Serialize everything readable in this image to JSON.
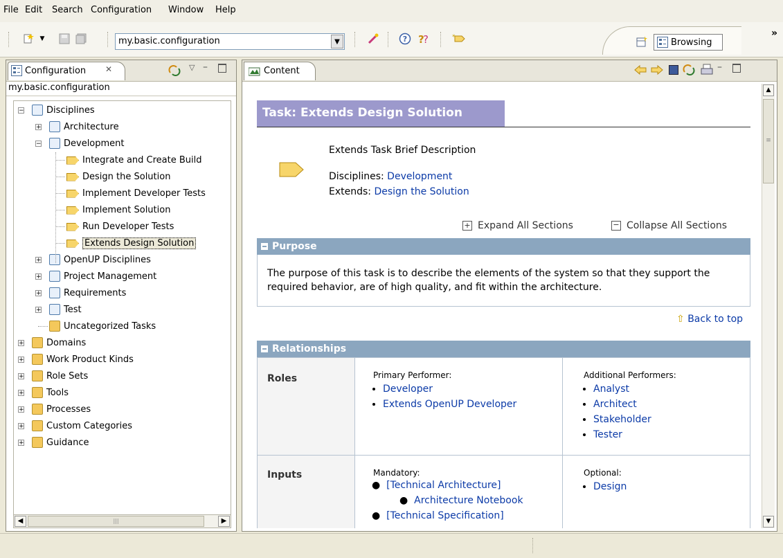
{
  "menu": [
    "File",
    "Edit",
    "Search",
    "Configuration",
    "Window",
    "Help"
  ],
  "toolbar": {
    "config_value": "my.basic.configuration",
    "perspective": "Browsing",
    "chevron": "»"
  },
  "library_view": {
    "tab_title": "Configuration",
    "config_name": "my.basic.configuration",
    "tree": [
      {
        "label": "Disciplines",
        "expander": "−",
        "icon": "discipline-group-icon"
      },
      {
        "label": "Architecture",
        "expander": "+",
        "icon": "discipline-icon"
      },
      {
        "label": "Development",
        "expander": "−",
        "icon": "discipline-icon"
      },
      {
        "label": "Integrate and Create Build",
        "icon": "task-icon"
      },
      {
        "label": "Design the Solution",
        "icon": "task-icon"
      },
      {
        "label": "Implement Developer Tests",
        "icon": "task-icon"
      },
      {
        "label": "Implement Solution",
        "icon": "task-icon"
      },
      {
        "label": "Run Developer Tests",
        "icon": "task-icon"
      },
      {
        "label": "Extends Design Solution",
        "icon": "task-icon",
        "selected": true
      },
      {
        "label": "OpenUP Disciplines",
        "expander": "+",
        "icon": "discipline-icon"
      },
      {
        "label": "Project Management",
        "expander": "+",
        "icon": "discipline-icon"
      },
      {
        "label": "Requirements",
        "expander": "+",
        "icon": "discipline-icon"
      },
      {
        "label": "Test",
        "expander": "+",
        "icon": "discipline-icon"
      },
      {
        "label": "Uncategorized Tasks",
        "icon": "uncategorized-icon"
      },
      {
        "label": "Domains",
        "expander": "+",
        "icon": "domain-folder-icon"
      },
      {
        "label": "Work Product Kinds",
        "expander": "+",
        "icon": "wpkind-folder-icon"
      },
      {
        "label": "Role Sets",
        "expander": "+",
        "icon": "roleset-folder-icon"
      },
      {
        "label": "Tools",
        "expander": "+",
        "icon": "tools-folder-icon"
      },
      {
        "label": "Processes",
        "expander": "+",
        "icon": "processes-folder-icon"
      },
      {
        "label": "Custom Categories",
        "expander": "+",
        "icon": "custom-folder-icon"
      },
      {
        "label": "Guidance",
        "expander": "+",
        "icon": "guidance-folder-icon"
      }
    ]
  },
  "content_view": {
    "tab_title": "Content",
    "task_title": "Task: Extends Design Solution",
    "brief": "Extends Task Brief Description",
    "disciplines_label": "Disciplines:",
    "disciplines_link": "Development",
    "extends_label": "Extends:",
    "extends_link": "Design the Solution",
    "expand_all": "Expand All Sections",
    "collapse_all": "Collapse All Sections",
    "purpose_title": "Purpose",
    "purpose_text": "The purpose of this task is to describe the elements of the system so that they support the required behavior, are of high quality, and fit within the architecture.",
    "back_to_top": "Back to top",
    "relationships_title": "Relationships",
    "roles_label": "Roles",
    "primary_label": "Primary Performer:",
    "primary_items": [
      "Developer",
      "Extends OpenUP Developer"
    ],
    "additional_label": "Additional Performers:",
    "additional_items": [
      "Analyst",
      "Architect",
      "Stakeholder",
      "Tester"
    ],
    "inputs_label": "Inputs",
    "mandatory_label": "Mandatory:",
    "mandatory_items": [
      "[Technical Architecture]",
      "Architecture Notebook",
      "[Technical Specification]"
    ],
    "optional_label": "Optional:",
    "optional_items": [
      "Design"
    ]
  }
}
